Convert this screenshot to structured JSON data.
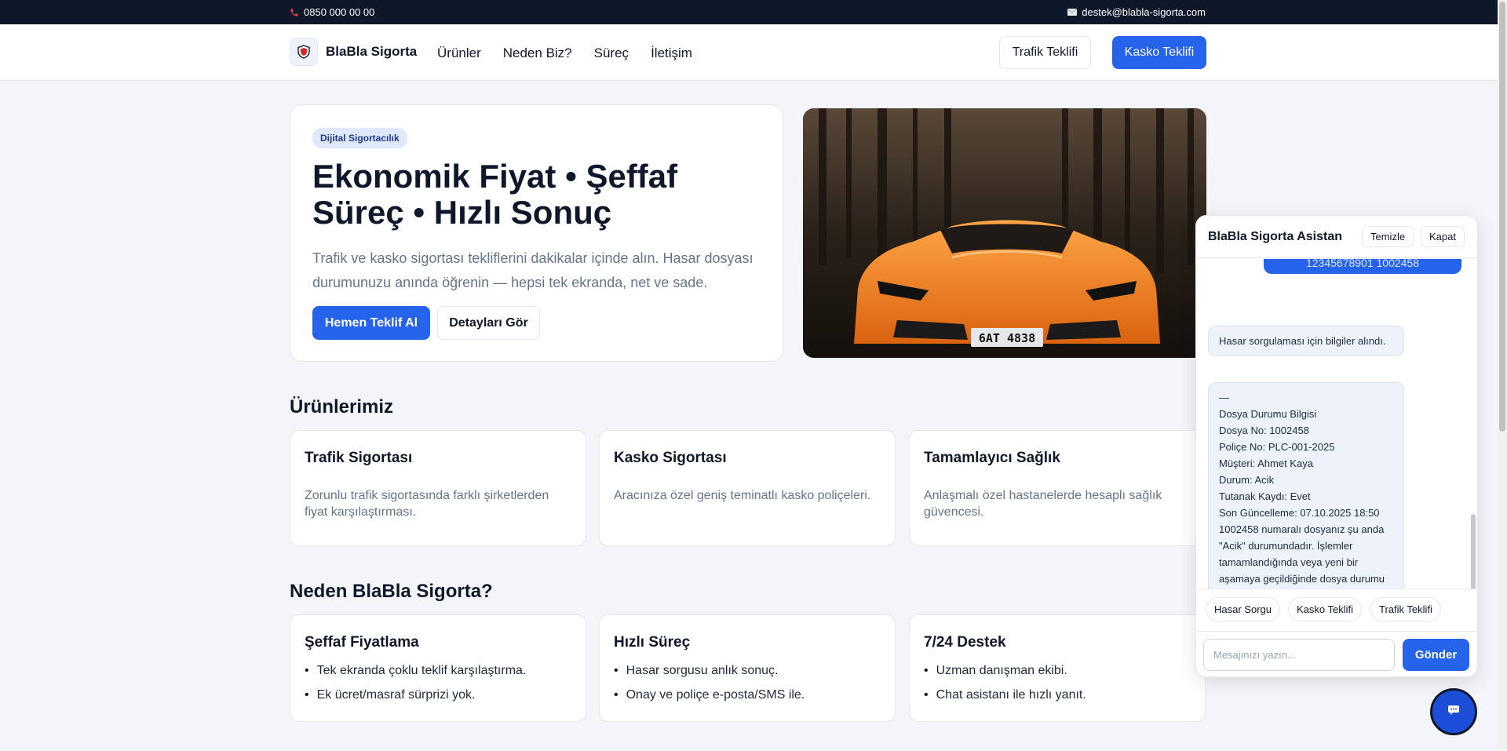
{
  "topbar": {
    "phone": "0850 000 00 00",
    "email": "destek@blabla-sigorta.com"
  },
  "header": {
    "brand": "BlaBla Sigorta",
    "nav": [
      "Ürünler",
      "Neden Biz?",
      "Süreç",
      "İletişim"
    ],
    "traffic_button": "Trafik Teklifi",
    "kasko_button": "Kasko Teklifi"
  },
  "hero": {
    "badge": "Dijital Sigortacılık",
    "title": "Ekonomik Fiyat • Şeffaf Süreç • Hızlı Sonuç",
    "description": "Trafik ve kasko sigortası tekliflerini dakikalar içinde alın. Hasar dosyası durumunuzu anında öğrenin — hepsi tek ekranda, net ve sade.",
    "primary_button": "Hemen Teklif Al",
    "secondary_button": "Detayları Gör",
    "image_plate": "6AT 4838"
  },
  "products": {
    "title": "Ürünlerimiz",
    "items": [
      {
        "title": "Trafik Sigortası",
        "desc": "Zorunlu trafik sigortasında farklı şirketlerden fiyat karşılaştırması."
      },
      {
        "title": "Kasko Sigortası",
        "desc": "Aracınıza özel geniş teminatlı kasko poliçeleri."
      },
      {
        "title": "Tamamlayıcı Sağlık",
        "desc": "Anlaşmalı özel hastanelerde hesaplı sağlık güvencesi."
      }
    ]
  },
  "why": {
    "title": "Neden BlaBla Sigorta?",
    "items": [
      {
        "title": "Şeffaf Fiyatlama",
        "points": [
          "Tek ekranda çoklu teklif karşılaştırma.",
          "Ek ücret/masraf sürprizi yok."
        ]
      },
      {
        "title": "Hızlı Süreç",
        "points": [
          "Hasar sorgusu anlık sonuç.",
          "Onay ve poliçe e-posta/SMS ile."
        ]
      },
      {
        "title": "7/24 Destek",
        "points": [
          "Uzman danışman ekibi.",
          "Chat asistanı ile hızlı yanıt."
        ]
      }
    ]
  },
  "chat": {
    "title": "BlaBla Sigorta Asistan",
    "clear_button": "Temizle",
    "close_button": "Kapat",
    "user_message": "12345678901 1002458",
    "bot_message_1": "Hasar sorgulaması için bilgiler alındı.",
    "bot_message_2": "—\nDosya Durumu Bilgisi\nDosya No: 1002458\nPoliçe No: PLC-001-2025\nMüşteri: Ahmet Kaya\nDurum: Acik\nTutanak Kaydı: Evet\nSon Güncelleme: 07.10.2025 18:50\n1002458 numaralı dosyanız şu anda \"Acik\" durumundadır. İşlemler tamamlandığında veya yeni bir aşamaya geçildiğinde dosya durumu güncellenecektir.",
    "quick_replies": [
      "Hasar Sorgu",
      "Kasko Teklifi",
      "Trafik Teklifi"
    ],
    "input_placeholder": "Mesajınızı yazın...",
    "send_button": "Gönder"
  },
  "colors": {
    "primary": "#2563eb",
    "dark": "#0f172a",
    "muted": "#64748b",
    "background": "#f3f5f9"
  }
}
